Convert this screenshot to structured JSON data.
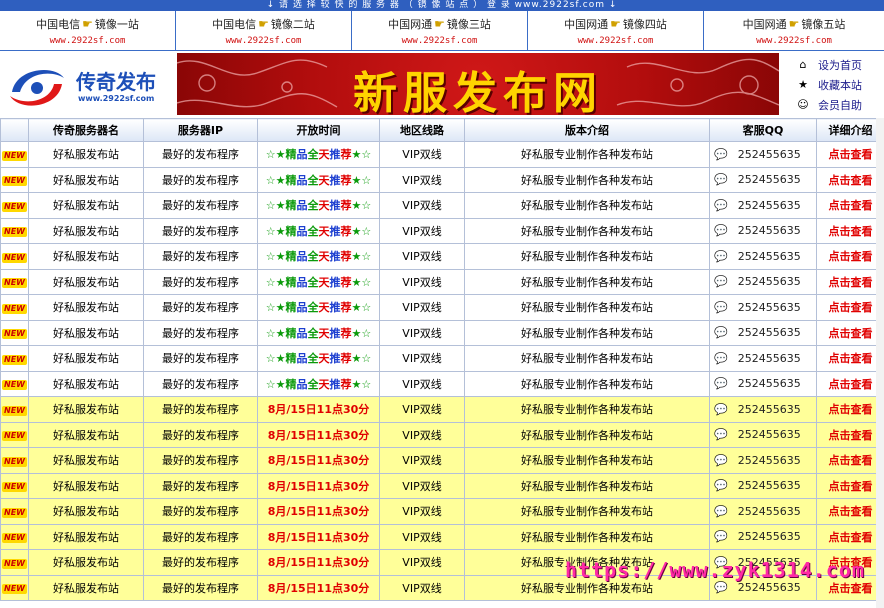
{
  "topbar": {
    "notice": "↓ 请 选 择 较 快 的 服 务 器 （ 镜 像 站 点 ） 登 录 www.2922sf.com ↓"
  },
  "mirrors": [
    {
      "isp": "中国电信",
      "name": "镜像一站",
      "url": "www.2922sf.com"
    },
    {
      "isp": "中国电信",
      "name": "镜像二站",
      "url": "www.2922sf.com"
    },
    {
      "isp": "中国网通",
      "name": "镜像三站",
      "url": "www.2922sf.com"
    },
    {
      "isp": "中国网通",
      "name": "镜像四站",
      "url": "www.2922sf.com"
    },
    {
      "isp": "中国网通",
      "name": "镜像五站",
      "url": "www.2922sf.com"
    }
  ],
  "logo": {
    "title": "传奇发布",
    "url": "www.2922sf.com"
  },
  "banner": {
    "title": "新服发布网"
  },
  "links": [
    {
      "icon": "home-icon",
      "label": "设为首页"
    },
    {
      "icon": "favorite-icon",
      "label": "收藏本站"
    },
    {
      "icon": "member-icon",
      "label": "会员自助"
    }
  ],
  "table": {
    "headers": [
      "",
      "传奇服务器名",
      "服务器IP",
      "开放时间",
      "地区线路",
      "版本介绍",
      "客服QQ",
      "详细介绍"
    ],
    "new_badge": "NEW",
    "server_name": "好私服发布站",
    "server_ip": "最好的发布程序",
    "recommend_text": "☆★精品全天推荐★☆",
    "open_time": "8月/15日11点30分",
    "region": "VIP双线",
    "version": "好私服专业制作各种发布站",
    "qq": "252455635",
    "detail": "点击查看",
    "recommended_rows": 10,
    "timed_rows": 8
  },
  "watermark": {
    "text": "https://www.zyk1314.com"
  },
  "colors": {
    "accent_blue": "#2f5fbf",
    "highlight_row": "#ffff99",
    "link_red": "#e00000",
    "banner_red": "#c01010",
    "banner_gold": "#ffd400"
  }
}
